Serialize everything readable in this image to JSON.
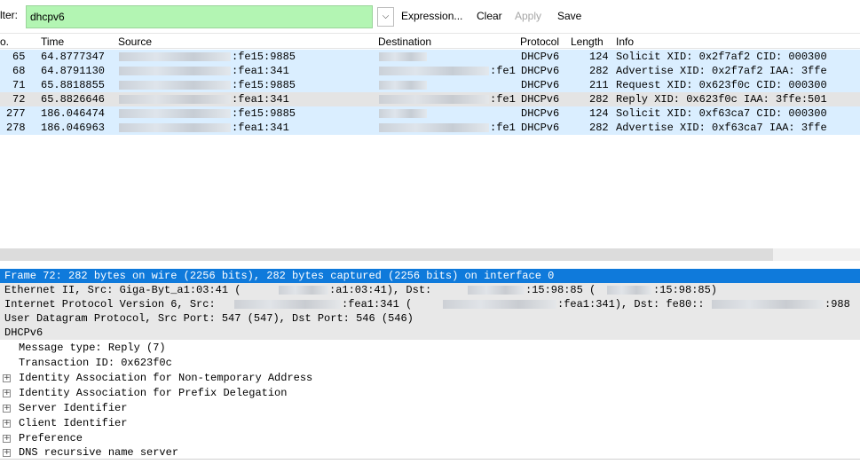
{
  "toolbar": {
    "filter_label": "lter:",
    "filter_value": "dhcpv6",
    "dropdown_glyph": "⌵",
    "expression_label": "Expression...",
    "clear_label": "Clear",
    "apply_label": "Apply",
    "save_label": "Save"
  },
  "packet_list": {
    "columns": {
      "no": "o.",
      "time": "Time",
      "source": "Source",
      "destination": "Destination",
      "protocol": "Protocol",
      "length": "Length",
      "info": "Info"
    },
    "rows": [
      {
        "no": "65",
        "time": "64.8777347",
        "source": ":fe15:9885",
        "destination": "",
        "protocol": "DHCPv6",
        "length": "124",
        "info": "Solicit XID: 0x2f7af2 CID: 000300"
      },
      {
        "no": "68",
        "time": "64.8791130",
        "source": ":fea1:341",
        "destination": ":fe1",
        "protocol": "DHCPv6",
        "length": "282",
        "info": "Advertise XID: 0x2f7af2 IAA: 3ffe"
      },
      {
        "no": "71",
        "time": "65.8818855",
        "source": ":fe15:9885",
        "destination": "",
        "protocol": "DHCPv6",
        "length": "211",
        "info": "Request XID: 0x623f0c CID: 000300"
      },
      {
        "no": "72",
        "time": "65.8826646",
        "source": ":fea1:341",
        "destination": ":fe1",
        "protocol": "DHCPv6",
        "length": "282",
        "info": "Reply XID: 0x623f0c IAA: 3ffe:501"
      },
      {
        "no": "277",
        "time": "186.046474",
        "source": ":fe15:9885",
        "destination": "",
        "protocol": "DHCPv6",
        "length": "124",
        "info": "Solicit XID: 0xf63ca7 CID: 000300"
      },
      {
        "no": "278",
        "time": "186.046963",
        "source": ":fea1:341",
        "destination": ":fe1",
        "protocol": "DHCPv6",
        "length": "282",
        "info": "Advertise XID: 0xf63ca7 IAA: 3ffe"
      }
    ]
  },
  "details": {
    "frame": "Frame 72: 282 bytes on wire (2256 bits), 282 bytes captured (2256 bits) on interface 0",
    "ethernet_a": "Ethernet II, Src: Giga-Byt_a1:03:41 (",
    "ethernet_b": ":a1:03:41), Dst:",
    "ethernet_c": ":15:98:85 (",
    "ethernet_d": ":15:98:85)",
    "ipv6_a": "Internet Protocol Version 6, Src:",
    "ipv6_b": ":fea1:341 (",
    "ipv6_c": ":fea1:341), Dst: fe80::",
    "ipv6_d": ":988",
    "udp": "User Datagram Protocol, Src Port: 547 (547), Dst Port: 546 (546)",
    "dhcpv6": "DHCPv6",
    "message_type": "Message type: Reply (7)",
    "transaction_id": "Transaction ID: 0x623f0c",
    "expand_glyph": "+",
    "items": [
      "Identity Association for Non-temporary Address",
      "Identity Association for Prefix Delegation",
      "Server Identifier",
      "Client Identifier",
      "Preference",
      "DNS recursive name server"
    ]
  },
  "colors": {
    "filter_valid": "#b3f5b3",
    "row_udp": "#daeeff",
    "selected_detail": "#0f7adb"
  }
}
